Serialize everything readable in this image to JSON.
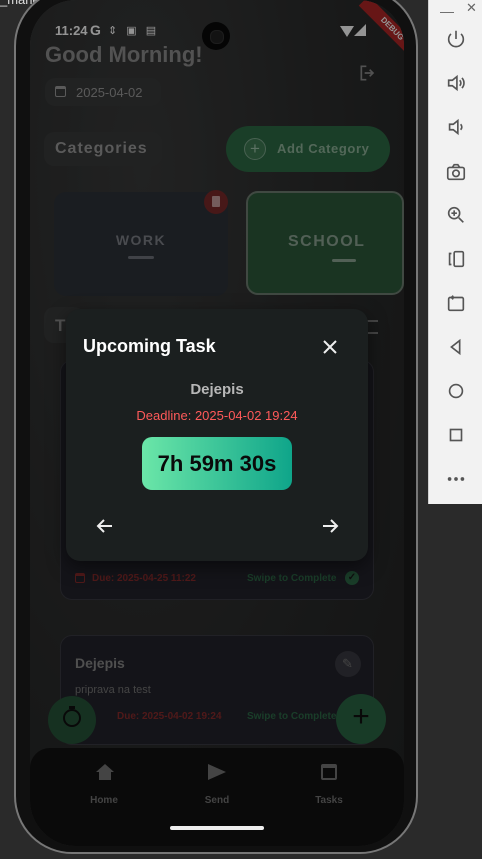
{
  "status_bar": {
    "time": "11:24",
    "g_letter": "G",
    "debug_badge": "DEBUG"
  },
  "header": {
    "greeting": "Good Morning!",
    "date": "2025-04-02"
  },
  "categories": {
    "title": "Categories",
    "add_label": "Add Category",
    "items": [
      "WORK",
      "SCHOOL"
    ]
  },
  "tasks_partial_letter": "T",
  "task_card_1": {
    "due": "Due: 2025-04-25 11:22",
    "swipe": "Swipe to Complete"
  },
  "task_card_2": {
    "title": "Dejepis",
    "description": "priprava na test",
    "due": "Due: 2025-04-02 19:24",
    "swipe": "Swipe to Complete"
  },
  "dialog": {
    "title": "Upcoming Task",
    "task_name": "Dejepis",
    "deadline": "Deadline: 2025-04-02 19:24",
    "countdown": "7h 59m 30s"
  },
  "bottom_nav": {
    "items": [
      {
        "label": "Home",
        "icon": "home-icon"
      },
      {
        "label": "Send",
        "icon": "send-icon"
      },
      {
        "label": "Tasks",
        "icon": "calendar-icon"
      }
    ]
  },
  "fabs": {
    "timer_icon": "timer-icon",
    "add_icon": "plus-icon"
  },
  "side_panel": {
    "icons": [
      "power-icon",
      "volume-up-icon",
      "volume-down-icon",
      "camera-icon",
      "zoom-in-icon",
      "rotate-left-icon",
      "rotate-right-icon",
      "back-icon",
      "home-circle-icon",
      "overview-icon",
      "more-icon"
    ]
  },
  "colors": {
    "accent_green": "#2e7d4f",
    "gradient_start": "#6be6a8",
    "gradient_end": "#0fa58a",
    "deadline_red": "#ff5a5a",
    "dialog_bg": "#1b1f1f"
  }
}
